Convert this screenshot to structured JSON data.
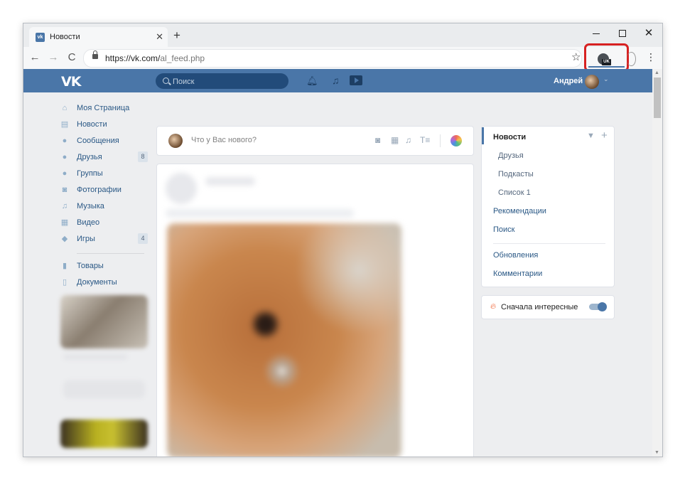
{
  "browser": {
    "tab": {
      "title": "Новости",
      "favicon": "vk-favicon-icon",
      "close_glyph": "✕"
    },
    "new_tab_glyph": "+",
    "window_controls": {
      "close_glyph": "✕"
    },
    "nav": {
      "back": "←",
      "forward": "→",
      "reload": "C"
    },
    "address": {
      "host": "https://vk.com/",
      "path": "al_feed.php"
    },
    "bookmark_glyph": "☆",
    "extension": {
      "badge": "UK",
      "icon": "vk-extension-icon",
      "highlight_color": "#d72121"
    },
    "menu_glyph": "⋮"
  },
  "header": {
    "logo": "VK",
    "search_placeholder": "Поиск",
    "user_name": "Андрей",
    "accent_color": "#4a76a8"
  },
  "left_nav": [
    {
      "label": "Моя Страница",
      "icon": "home-icon",
      "glyph": "⌂"
    },
    {
      "label": "Новости",
      "icon": "news-icon",
      "glyph": "▤"
    },
    {
      "label": "Сообщения",
      "icon": "messages-icon",
      "glyph": "●"
    },
    {
      "label": "Друзья",
      "icon": "friends-icon",
      "glyph": "●",
      "count": "8"
    },
    {
      "label": "Группы",
      "icon": "groups-icon",
      "glyph": "●"
    },
    {
      "label": "Фотографии",
      "icon": "photos-icon",
      "glyph": "◙"
    },
    {
      "label": "Музыка",
      "icon": "music-icon",
      "glyph": "♫"
    },
    {
      "label": "Видео",
      "icon": "video-icon",
      "glyph": "▦"
    },
    {
      "label": "Игры",
      "icon": "games-icon",
      "glyph": "◆",
      "count": "4"
    }
  ],
  "left_nav_secondary": [
    {
      "label": "Товары",
      "icon": "goods-icon",
      "glyph": "▮"
    },
    {
      "label": "Документы",
      "icon": "documents-icon",
      "glyph": "▯"
    }
  ],
  "composer": {
    "placeholder": "Что у Вас нового?",
    "icons": [
      "camera-icon",
      "video-icon",
      "music-icon",
      "text-icon",
      "colors-icon"
    ]
  },
  "right_menu": {
    "active": "Новости",
    "sub_items": [
      "Друзья",
      "Подкасты",
      "Список 1"
    ],
    "items": [
      "Рекомендации",
      "Поиск"
    ],
    "items_after_sep": [
      "Обновления",
      "Комментарии"
    ]
  },
  "interest": {
    "label": "Сначала интересные",
    "enabled": true
  }
}
